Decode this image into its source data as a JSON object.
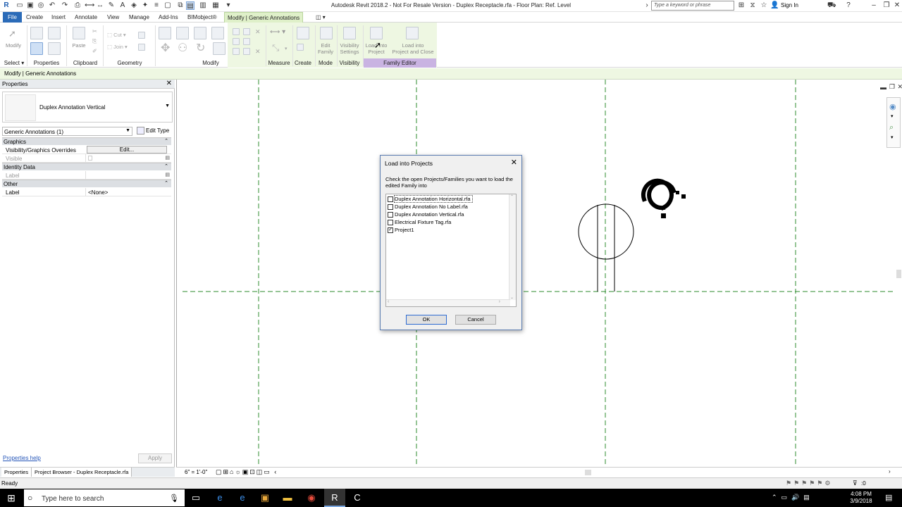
{
  "window": {
    "title": "Autodesk Revit 2018.2 - Not For Resale Version -    Duplex Receptacle.rfa - Floor Plan: Ref. Level",
    "search_placeholder": "Type a keyword or phrase",
    "sign_in": "Sign In"
  },
  "ribbon": {
    "tabs": [
      "File",
      "Create",
      "Insert",
      "Annotate",
      "View",
      "Manage",
      "Add-Ins",
      "BIMobject®",
      "Modify | Generic Annotations"
    ],
    "buttons": {
      "modify": "Modify",
      "paste": "Paste",
      "cut": "Cut",
      "join": "Join",
      "edit_family": "Edit\nFamily",
      "visibility_settings": "Visibility\nSettings",
      "load_into_project": "Load into\nProject",
      "load_into_project_close": "Load into\nProject and Close"
    },
    "panels": [
      "Select ▾",
      "Properties",
      "Clipboard",
      "Geometry",
      "Modify",
      "Measure",
      "Create",
      "Mode",
      "Visibility",
      "Family Editor"
    ]
  },
  "options_bar": {
    "context": "Modify | Generic Annotations"
  },
  "properties": {
    "title": "Properties",
    "type_name": "Duplex Annotation Vertical",
    "instance_filter": "Generic Annotations (1)",
    "edit_type": "Edit Type",
    "groups": [
      {
        "name": "Graphics",
        "rows": [
          {
            "key": "Visibility/Graphics Overrides",
            "value": "Edit...",
            "button": true
          },
          {
            "key": "Visible",
            "value": "",
            "dim": true
          }
        ]
      },
      {
        "name": "Identity Data",
        "rows": [
          {
            "key": "Label",
            "value": "",
            "dim": true
          }
        ]
      },
      {
        "name": "Other",
        "rows": [
          {
            "key": "Label",
            "value": "<None>"
          }
        ]
      }
    ],
    "help_link": "Properties help",
    "apply": "Apply"
  },
  "panel_tabs": [
    "Properties",
    "Project Browser - Duplex Receptacle.rfa"
  ],
  "view_bar": {
    "scale": "6\" = 1'-0\""
  },
  "status": {
    "text": "Ready",
    "count": ":0"
  },
  "dialog": {
    "title": "Load into Projects",
    "message": "Check the open Projects/Families you want to load the edited Family into",
    "items": [
      {
        "label": "Duplex Annotation Horizontal.rfa",
        "checked": false,
        "focused": true
      },
      {
        "label": "Duplex Annotation No Label.rfa",
        "checked": false
      },
      {
        "label": "Duplex Annotation Vertical.rfa",
        "checked": false
      },
      {
        "label": "Electrical Fixture Tag.rfa",
        "checked": false
      },
      {
        "label": "Project1",
        "checked": true
      }
    ],
    "ok": "OK",
    "cancel": "Cancel"
  },
  "taskbar": {
    "search_placeholder": "Type here to search",
    "time": "4:08 PM",
    "date": "3/9/2018"
  },
  "colors": {
    "file_tab": "#2b6bb8",
    "context_tab": "#dff0c9",
    "family_editor_panel": "#c9b3e2",
    "ref_plane": "#2e8b2e"
  }
}
